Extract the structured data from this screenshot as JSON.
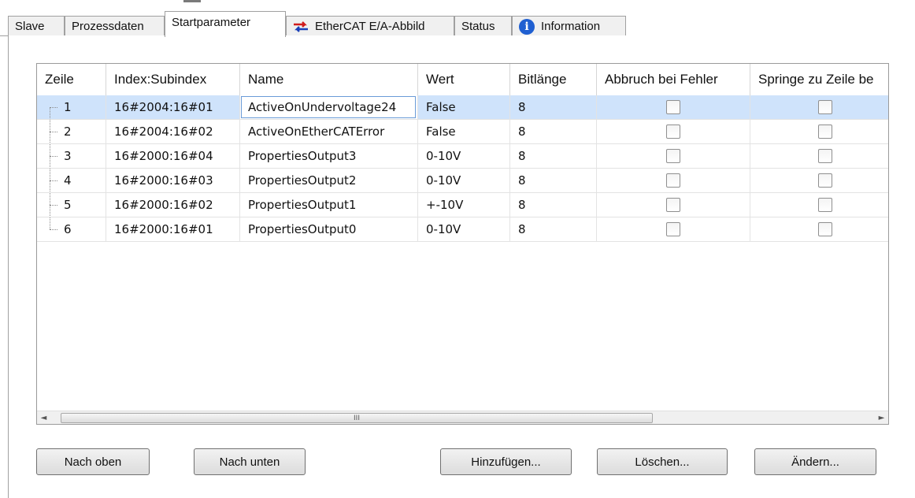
{
  "tabs": [
    {
      "label": "Slave",
      "icon": null,
      "active": false
    },
    {
      "label": "Prozessdaten",
      "icon": null,
      "active": false
    },
    {
      "label": "Startparameter",
      "icon": null,
      "active": true
    },
    {
      "label": "EtherCAT E/A-Abbild",
      "icon": "arrows-exchange-icon",
      "active": false
    },
    {
      "label": "Status",
      "icon": null,
      "active": false
    },
    {
      "label": "Information",
      "icon": "info-icon",
      "active": false
    }
  ],
  "grid": {
    "columns": [
      "Zeile",
      "Index:Subindex",
      "Name",
      "Wert",
      "Bitlänge",
      "Abbruch bei Fehler",
      "Springe zu Zeile be"
    ],
    "rows": [
      {
        "zeile": "1",
        "index": "16#2004:16#01",
        "name": "ActiveOnUndervoltage24",
        "wert": "False",
        "bitlaenge": "8",
        "abbruch": false,
        "springe": false,
        "selected": true
      },
      {
        "zeile": "2",
        "index": "16#2004:16#02",
        "name": "ActiveOnEtherCATError",
        "wert": "False",
        "bitlaenge": "8",
        "abbruch": false,
        "springe": false,
        "selected": false
      },
      {
        "zeile": "3",
        "index": "16#2000:16#04",
        "name": "PropertiesOutput3",
        "wert": "0-10V",
        "bitlaenge": "8",
        "abbruch": false,
        "springe": false,
        "selected": false
      },
      {
        "zeile": "4",
        "index": "16#2000:16#03",
        "name": "PropertiesOutput2",
        "wert": "0-10V",
        "bitlaenge": "8",
        "abbruch": false,
        "springe": false,
        "selected": false
      },
      {
        "zeile": "5",
        "index": "16#2000:16#02",
        "name": "PropertiesOutput1",
        "wert": "+-10V",
        "bitlaenge": "8",
        "abbruch": false,
        "springe": false,
        "selected": false
      },
      {
        "zeile": "6",
        "index": "16#2000:16#01",
        "name": "PropertiesOutput0",
        "wert": "0-10V",
        "bitlaenge": "8",
        "abbruch": false,
        "springe": false,
        "selected": false
      }
    ],
    "scroll_grip": "III",
    "scroll_left": "◄",
    "scroll_right": "►"
  },
  "buttons": {
    "up": "Nach oben",
    "down": "Nach unten",
    "add": "Hinzufügen...",
    "delete": "Löschen...",
    "edit": "Ändern..."
  },
  "colors": {
    "selected_row": "#cfe3fb",
    "info_icon": "#1f5fd1",
    "exchange_icon_red": "#d01c1c",
    "exchange_icon_blue": "#1a3fb8"
  }
}
